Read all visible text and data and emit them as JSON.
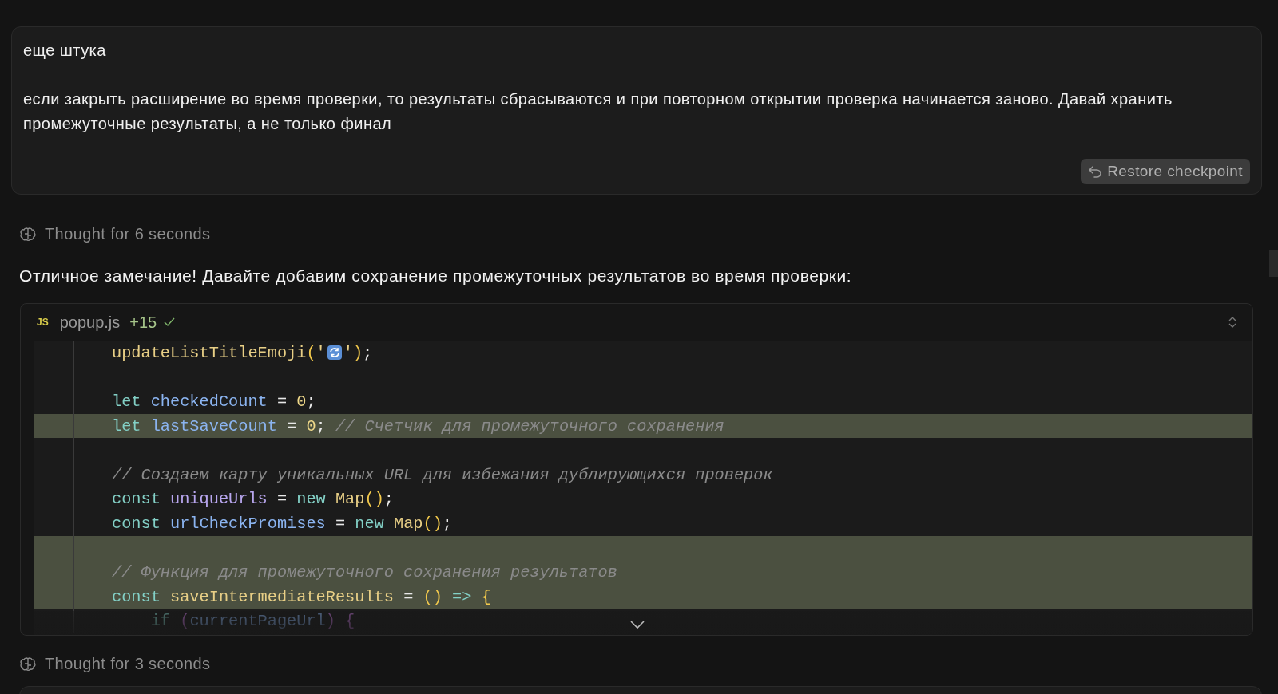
{
  "user_message": {
    "paragraphs": [
      "еще штука",
      "если закрыть расширение во время проверки, то результаты сбрасываются и при повторном открытии проверка начинается заново. Давай хранить промежуточные результаты, а не только финал"
    ],
    "restore_button": "Restore checkpoint"
  },
  "thoughts": [
    "Thought for 6 seconds",
    "Thought for 3 seconds"
  ],
  "answer": "Отличное замечание! Давайте добавим сохранение промежуточных результатов во время проверки:",
  "code_block": {
    "badge": "JS",
    "filename": "popup.js",
    "additions": "+15",
    "applied": true,
    "lines": [
      {
        "added": false,
        "tokens": [
          {
            "kind": "function",
            "text": "updateListTitleEmoji"
          },
          {
            "kind": "paren",
            "text": "("
          },
          {
            "kind": "string",
            "text": "'"
          },
          {
            "kind": "emoji"
          },
          {
            "kind": "string",
            "text": "'"
          },
          {
            "kind": "paren",
            "text": ")"
          },
          {
            "kind": "plain",
            "text": ";"
          }
        ]
      },
      {
        "added": false
      },
      {
        "added": false,
        "tokens": [
          {
            "kind": "keyword",
            "text": "let "
          },
          {
            "kind": "variable",
            "text": "checkedCount"
          },
          {
            "kind": "plain",
            "text": " = "
          },
          {
            "kind": "number",
            "text": "0"
          },
          {
            "kind": "plain",
            "text": ";"
          }
        ]
      },
      {
        "added": true,
        "tokens": [
          {
            "kind": "keyword",
            "text": "let "
          },
          {
            "kind": "variable",
            "text": "lastSaveCount"
          },
          {
            "kind": "plain",
            "text": " = "
          },
          {
            "kind": "number",
            "text": "0"
          },
          {
            "kind": "plain",
            "text": "; "
          },
          {
            "kind": "comment",
            "text": "// Счетчик для промежуточного сохранения"
          }
        ]
      },
      {
        "added": false
      },
      {
        "added": false,
        "tokens": [
          {
            "kind": "comment",
            "text": "// Создаем карту уникальных URL для избежания дублирующихся проверок"
          }
        ]
      },
      {
        "added": false,
        "tokens": [
          {
            "kind": "keyword",
            "text": "const "
          },
          {
            "kind": "variable2",
            "text": "uniqueUrls"
          },
          {
            "kind": "plain",
            "text": " = "
          },
          {
            "kind": "keyword",
            "text": "new "
          },
          {
            "kind": "function",
            "text": "Map"
          },
          {
            "kind": "paren",
            "text": "()"
          },
          {
            "kind": "plain",
            "text": ";"
          }
        ]
      },
      {
        "added": false,
        "tokens": [
          {
            "kind": "keyword",
            "text": "const "
          },
          {
            "kind": "variable",
            "text": "urlCheckPromises"
          },
          {
            "kind": "plain",
            "text": " = "
          },
          {
            "kind": "keyword",
            "text": "new "
          },
          {
            "kind": "function",
            "text": "Map"
          },
          {
            "kind": "paren",
            "text": "()"
          },
          {
            "kind": "plain",
            "text": ";"
          }
        ]
      },
      {
        "added": true
      },
      {
        "added": true,
        "tokens": [
          {
            "kind": "comment",
            "text": "// Функция для промежуточного сохранения результатов"
          }
        ]
      },
      {
        "added": true,
        "tokens": [
          {
            "kind": "keyword",
            "text": "const "
          },
          {
            "kind": "function",
            "text": "saveIntermediateResults"
          },
          {
            "kind": "plain",
            "text": " = "
          },
          {
            "kind": "paren",
            "text": "()"
          },
          {
            "kind": "keyword",
            "text": " => "
          },
          {
            "kind": "paren",
            "text": "{"
          }
        ]
      },
      {
        "added": false,
        "tokens": [
          {
            "kind": "keyword",
            "text": "    if "
          },
          {
            "kind": "paren2",
            "text": "("
          },
          {
            "kind": "variable",
            "text": "currentPageUrl"
          },
          {
            "kind": "paren2",
            "text": ")"
          },
          {
            "kind": "paren2",
            "text": " {"
          }
        ]
      }
    ]
  }
}
